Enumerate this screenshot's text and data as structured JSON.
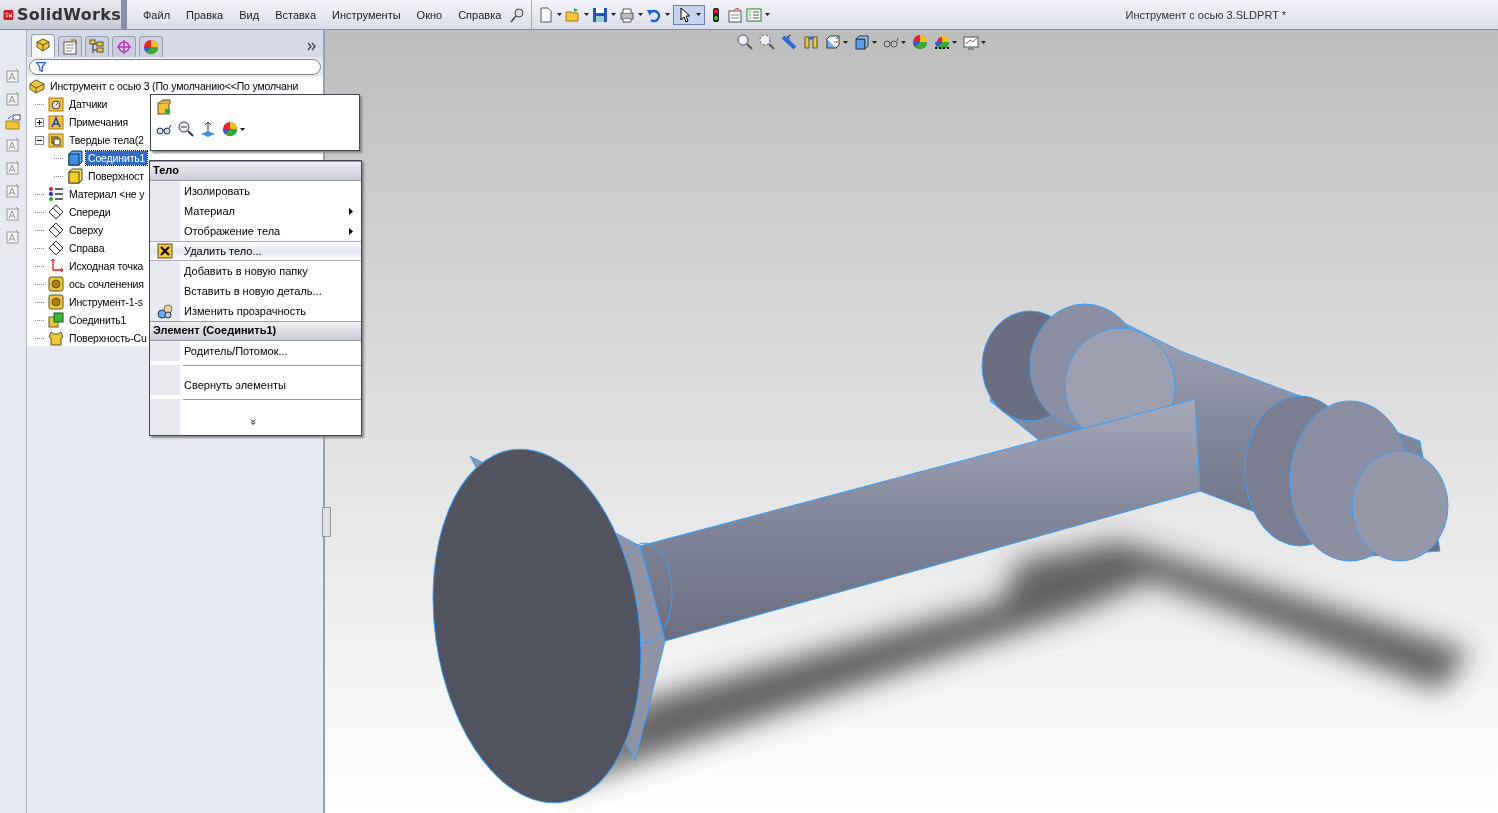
{
  "app_name": "SolidWorks",
  "menu_bar": [
    "Файл",
    "Правка",
    "Вид",
    "Вставка",
    "Инструменты",
    "Окно",
    "Справка"
  ],
  "document_title": "Инструмент с осью 3.SLDPRT *",
  "panel_tabs": [
    {
      "kind": "features",
      "selected": true
    },
    {
      "kind": "properties",
      "selected": false
    },
    {
      "kind": "configurations",
      "selected": false
    },
    {
      "kind": "dimxpert",
      "selected": false
    },
    {
      "kind": "display",
      "selected": false
    }
  ],
  "tree": {
    "label": "Инструмент с осью 3  (По умолчанию<<По умолчани",
    "kind": "part",
    "selected": false,
    "children": [
      {
        "label": "Датчики",
        "kind": "sensors",
        "selected": false
      },
      {
        "label": "Примечания",
        "kind": "annotations",
        "selected": false,
        "expanded": false
      },
      {
        "label": "Твердые тела(2",
        "kind": "bodies",
        "selected": false,
        "expanded": true,
        "children": [
          {
            "label": "Соединить1",
            "kind": "solid_body",
            "selected": true
          },
          {
            "label": "Поверхност",
            "kind": "surface_body",
            "selected": false
          }
        ]
      },
      {
        "label": "Материал <не у",
        "kind": "material",
        "selected": false
      },
      {
        "label": "Спереди",
        "kind": "plane",
        "selected": false
      },
      {
        "label": "Сверху",
        "kind": "plane",
        "selected": false
      },
      {
        "label": "Справа",
        "kind": "plane",
        "selected": false
      },
      {
        "label": "Исходная точка",
        "kind": "origin",
        "selected": false
      },
      {
        "label": "ось  сочленения",
        "kind": "feature",
        "selected": false
      },
      {
        "label": "Инструмент-1-s",
        "kind": "feature",
        "selected": false
      },
      {
        "label": "Соединить1",
        "kind": "combine",
        "selected": false
      },
      {
        "label": "Поверхность-Cu",
        "kind": "surface",
        "selected": false
      }
    ]
  },
  "context_menu": [
    {
      "kind": "header",
      "label": "Тело"
    },
    {
      "kind": "item",
      "label": "Изолировать",
      "submenu": false,
      "highlighted": false
    },
    {
      "kind": "item",
      "label": "Материал",
      "submenu": true,
      "highlighted": false
    },
    {
      "kind": "item",
      "label": "Отображение тела",
      "submenu": true,
      "highlighted": false
    },
    {
      "kind": "delete",
      "label": "Удалить тело...",
      "submenu": false,
      "highlighted": true
    },
    {
      "kind": "item",
      "label": "Добавить в новую папку",
      "submenu": false,
      "highlighted": false
    },
    {
      "kind": "item",
      "label": "Вставить в новую деталь...",
      "submenu": false,
      "highlighted": false
    },
    {
      "kind": "transparency",
      "label": "Изменить прозрачность",
      "submenu": false,
      "highlighted": false
    },
    {
      "kind": "header",
      "label": "Элемент (Соединить1)"
    },
    {
      "kind": "item",
      "label": "Родитель/Потомок...",
      "submenu": false,
      "highlighted": false
    },
    {
      "kind": "separator"
    },
    {
      "kind": "item",
      "label": "Свернуть элементы",
      "submenu": false,
      "highlighted": false
    },
    {
      "kind": "separator"
    },
    {
      "kind": "more",
      "label": "»"
    }
  ]
}
